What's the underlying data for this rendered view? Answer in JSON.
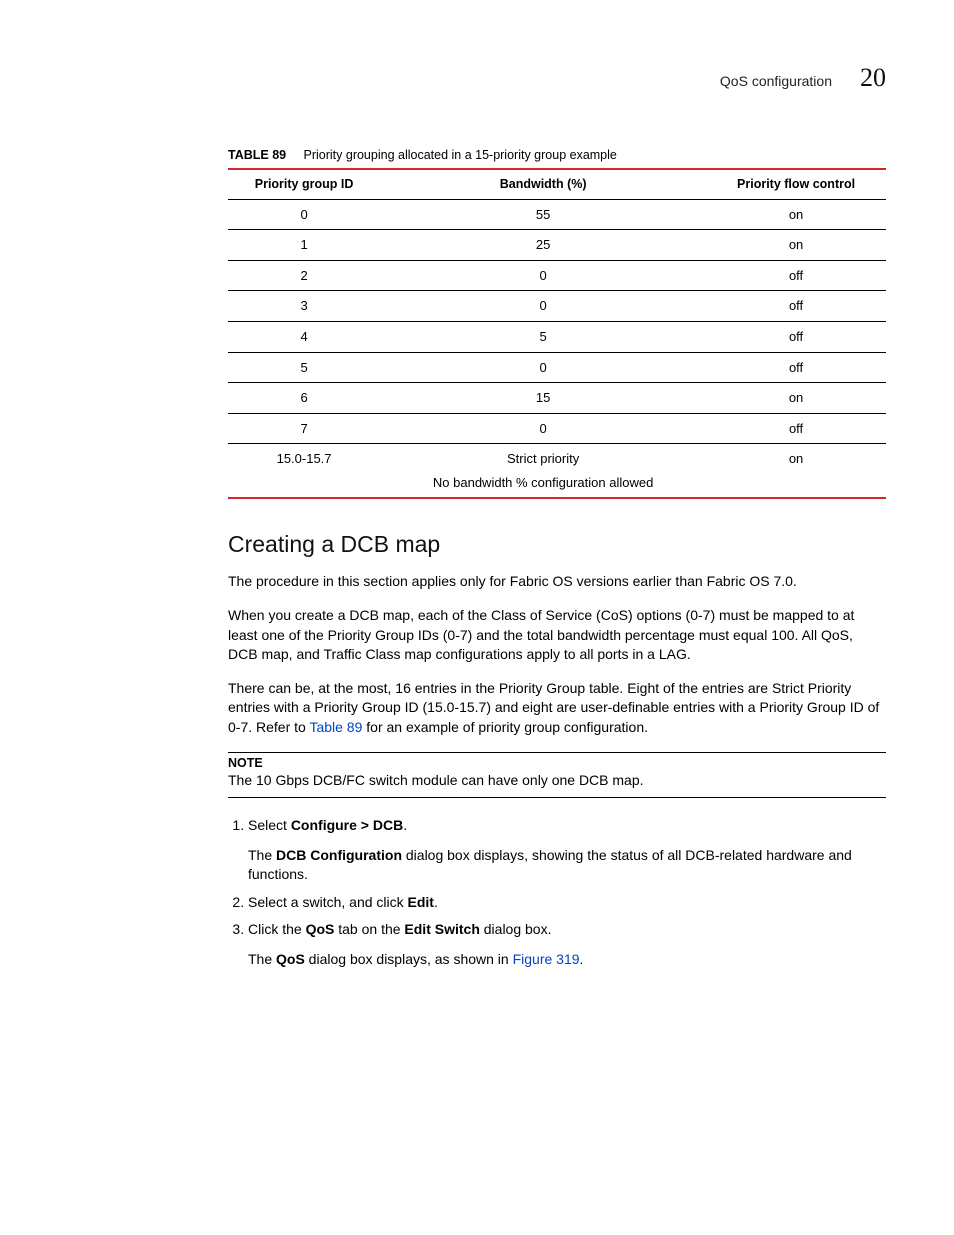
{
  "header": {
    "title": "QoS configuration",
    "chapter": "20"
  },
  "table": {
    "labelPrefix": "TABLE 89",
    "caption": "Priority grouping allocated in a 15-priority group example",
    "headers": [
      "Priority group ID",
      "Bandwidth (%)",
      "Priority flow control"
    ],
    "rows": [
      {
        "id": "0",
        "bw": "55",
        "pfc": "on"
      },
      {
        "id": "1",
        "bw": "25",
        "pfc": "on"
      },
      {
        "id": "2",
        "bw": "0",
        "pfc": "off"
      },
      {
        "id": "3",
        "bw": "0",
        "pfc": "off"
      },
      {
        "id": "4",
        "bw": "5",
        "pfc": "off"
      },
      {
        "id": "5",
        "bw": "0",
        "pfc": "off"
      },
      {
        "id": "6",
        "bw": "15",
        "pfc": "on"
      },
      {
        "id": "7",
        "bw": "0",
        "pfc": "off"
      }
    ],
    "lastRow": {
      "id": "15.0-15.7",
      "bw1": "Strict priority",
      "bw2": "No bandwidth % configuration allowed",
      "pfc": "on"
    }
  },
  "section": {
    "heading": "Creating a DCB map",
    "p1": "The procedure in this section applies only for Fabric OS versions earlier than Fabric OS 7.0.",
    "p2": "When you create a DCB map, each of the Class of Service (CoS) options (0-7) must be mapped to at least one of the Priority Group IDs (0-7) and the total bandwidth percentage must equal 100. All QoS, DCB map, and Traffic Class map configurations apply to all ports in a LAG.",
    "p3a": "There can be, at the most, 16 entries in the Priority Group table. Eight of the entries are Strict Priority entries with a Priority Group ID (15.0-15.7) and eight are user-definable entries with a Priority Group ID of 0-7. Refer to ",
    "p3link": "Table 89",
    "p3b": " for an example of priority group configuration."
  },
  "note": {
    "label": "NOTE",
    "text": "The 10 Gbps DCB/FC switch module can have only one DCB map."
  },
  "steps": {
    "s1a": "Select ",
    "s1b": "Configure > DCB",
    "s1c": ".",
    "s1body_a": "The ",
    "s1body_b": "DCB Configuration",
    "s1body_c": " dialog box displays, showing the status of all DCB-related hardware and functions.",
    "s2a": "Select a switch, and click ",
    "s2b": "Edit",
    "s2c": ".",
    "s3a": "Click the ",
    "s3b": "QoS",
    "s3c": " tab on the ",
    "s3d": "Edit Switch",
    "s3e": " dialog box.",
    "s3body_a": "The ",
    "s3body_b": "QoS",
    "s3body_c": " dialog box displays, as shown in ",
    "s3body_link": "Figure 319",
    "s3body_d": "."
  }
}
